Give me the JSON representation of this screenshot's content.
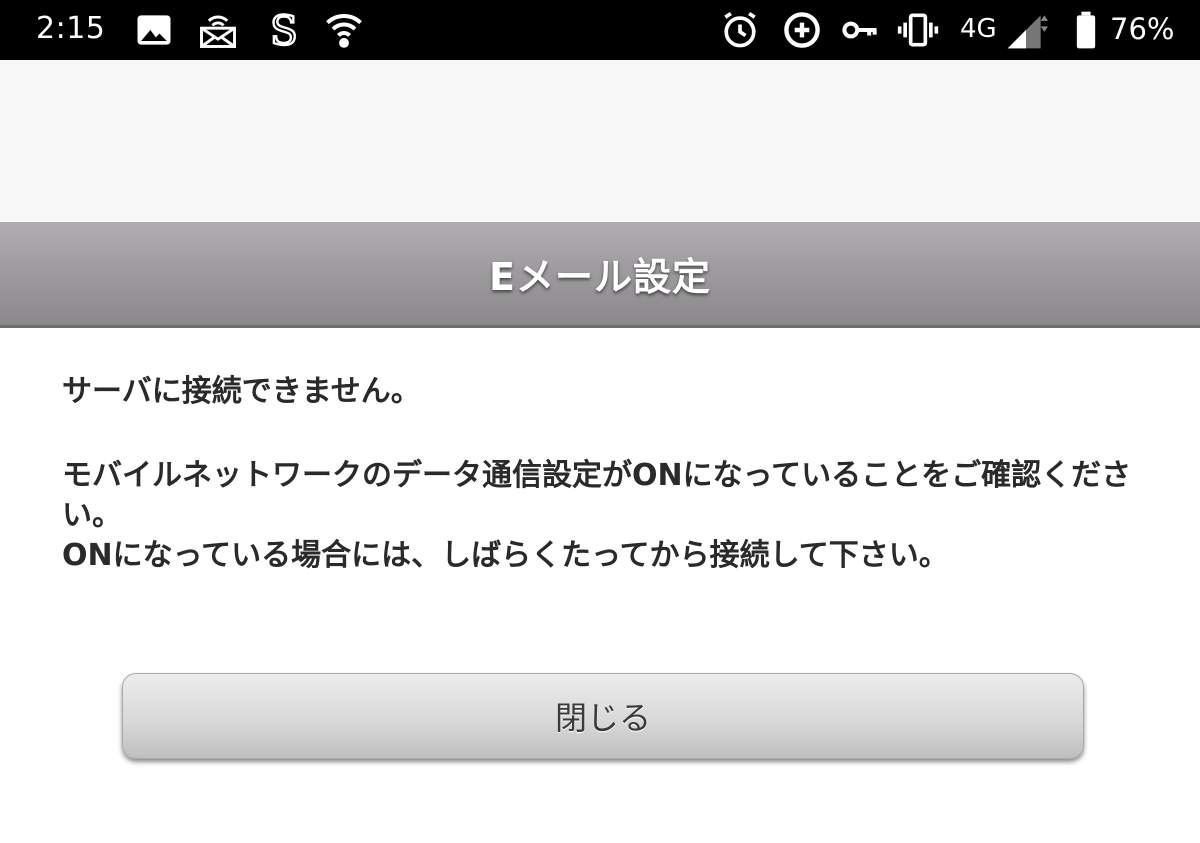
{
  "status_bar": {
    "time": "2:15",
    "network": "4G",
    "battery_percent": "76%",
    "icons": [
      "image-icon",
      "cast-signal-icon",
      "s-app-icon",
      "shield-icon",
      "alarm-icon",
      "data-saver-icon",
      "vpn-key-icon",
      "vibrate-icon",
      "cell-signal-icon",
      "battery-icon"
    ]
  },
  "dialog": {
    "title": "Eメール設定",
    "message_line1": "サーバに接続できません。",
    "message_line2": "モバイルネットワークのデータ通信設定がONになっていることをご確認ください。",
    "message_line3": "ONになっている場合には、しばらくたってから接続して下さい。",
    "close_button_label": "閉じる"
  },
  "colors": {
    "status_bar_bg": "#000000",
    "header_bg": "#9c9a9c",
    "button_bg": "#d9d9d9",
    "text": "#2a2a2a"
  }
}
